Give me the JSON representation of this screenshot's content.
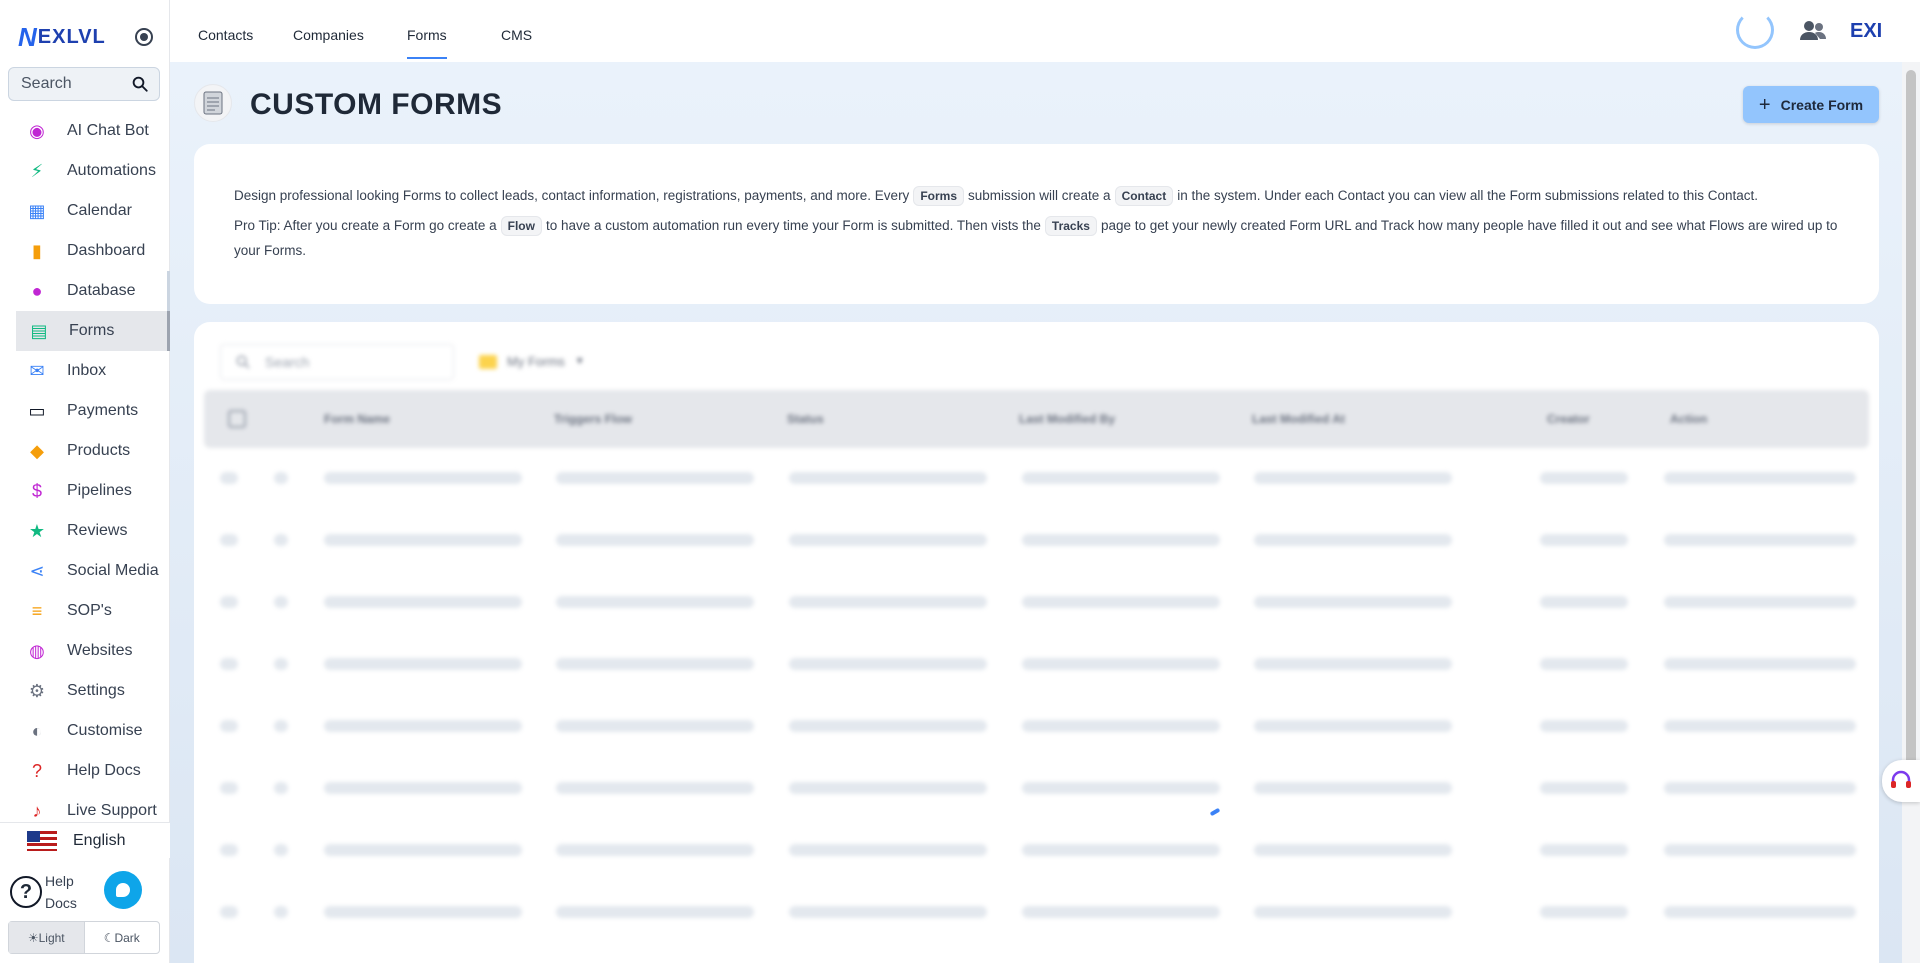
{
  "sidebar": {
    "brand": "EXLVL",
    "search_placeholder": "Search",
    "items": [
      {
        "label": "AI Chat Bot",
        "icon": "robot-icon",
        "color": "#c026d3"
      },
      {
        "label": "Automations",
        "icon": "bolt-icon",
        "color": "#10b981"
      },
      {
        "label": "Calendar",
        "icon": "calendar-icon",
        "color": "#3b82f6"
      },
      {
        "label": "Dashboard",
        "icon": "bar-chart-icon",
        "color": "#f59e0b"
      },
      {
        "label": "Database",
        "icon": "people-icon",
        "color": "#c026d3"
      },
      {
        "label": "Forms",
        "icon": "clipboard-icon",
        "color": "#10b981"
      },
      {
        "label": "Inbox",
        "icon": "mail-icon",
        "color": "#3b82f6"
      },
      {
        "label": "Payments",
        "icon": "card-icon",
        "color": "#111827"
      },
      {
        "label": "Products",
        "icon": "tag-icon",
        "color": "#f59e0b"
      },
      {
        "label": "Pipelines",
        "icon": "dollar-icon",
        "color": "#c026d3"
      },
      {
        "label": "Reviews",
        "icon": "star-icon",
        "color": "#10b981"
      },
      {
        "label": "Social Media",
        "icon": "share-icon",
        "color": "#3b82f6"
      },
      {
        "label": "SOP's",
        "icon": "checklist-icon",
        "color": "#f59e0b"
      },
      {
        "label": "Websites",
        "icon": "globe-icon",
        "color": "#c026d3"
      },
      {
        "label": "Settings",
        "icon": "gear-icon",
        "color": "#6b7280"
      },
      {
        "label": "Customise",
        "icon": "palette-icon",
        "color": "#6b7280"
      },
      {
        "label": "Help Docs",
        "icon": "question-icon",
        "color": "#dc2626"
      },
      {
        "label": "Live Support",
        "icon": "support-icon",
        "color": "#dc2626"
      }
    ],
    "language": "English",
    "help_line1": "Help",
    "help_line2": "Docs",
    "theme_light": "Light",
    "theme_dark": "Dark"
  },
  "topbar": {
    "tabs": [
      "Contacts",
      "Companies",
      "Forms",
      "CMS"
    ],
    "active_tab": "Forms",
    "brand_mini": "EXI"
  },
  "page": {
    "title": "CUSTOM FORMS",
    "create_button": "Create Form",
    "info_p1_a": "Design professional looking Forms to collect leads, contact information, registrations, payments, and more. Every",
    "chip_forms": "Forms",
    "info_p1_b": "submission will create a",
    "chip_contact": "Contact",
    "info_p1_c": "in the system. Under each Contact you can view all the Form submissions related to this Contact.",
    "info_p2_a": "Pro Tip: After you create a Form go create a",
    "chip_flow": "Flow",
    "info_p2_b": "to have a custom automation run every time your Form is submitted. Then vists the",
    "chip_tracks": "Tracks",
    "info_p2_c": "page to get your newly created Form URL and Track how many people have filled it out and see what Flows are wired up to your Forms."
  },
  "table": {
    "search_placeholder": "Search",
    "folder_label": "My Forms",
    "columns": [
      "Form Name",
      "Triggers Flow",
      "Status",
      "Last Modified By",
      "Last Modified At",
      "Creator",
      "Action"
    ],
    "skeleton_rows": 8
  }
}
